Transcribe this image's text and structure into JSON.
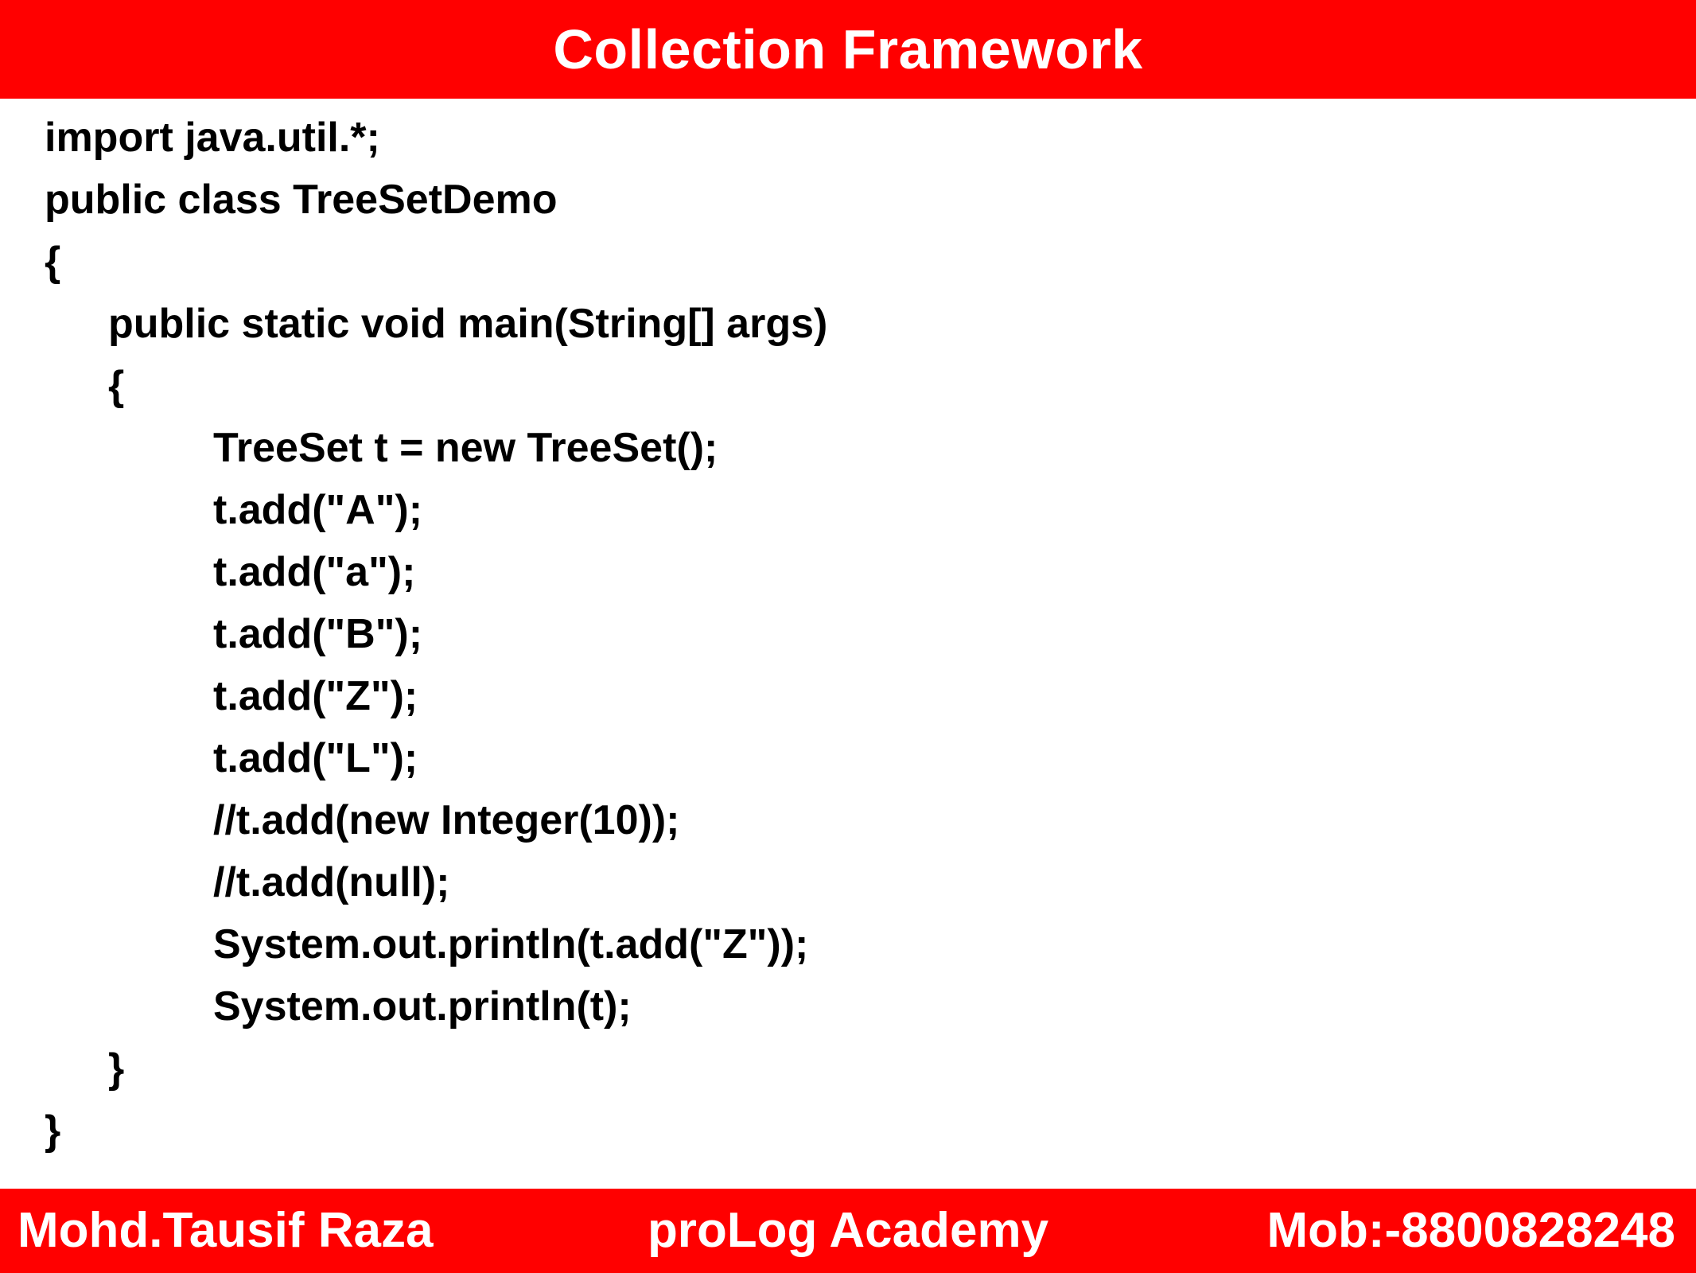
{
  "header": {
    "title": "Collection Framework"
  },
  "code": {
    "lines": [
      {
        "text": "import java.util.*;",
        "indent": 0
      },
      {
        "text": "public class TreeSetDemo",
        "indent": 0
      },
      {
        "text": "{",
        "indent": 0
      },
      {
        "text": "public static void main(String[] args)",
        "indent": 1
      },
      {
        "text": "{",
        "indent": 1
      },
      {
        "text": "TreeSet t = new TreeSet();",
        "indent": 2
      },
      {
        "text": "t.add(\"A\");",
        "indent": 2
      },
      {
        "text": "t.add(\"a\");",
        "indent": 2
      },
      {
        "text": "t.add(\"B\");",
        "indent": 2
      },
      {
        "text": "t.add(\"Z\");",
        "indent": 2
      },
      {
        "text": "t.add(\"L\");",
        "indent": 2
      },
      {
        "text": "//t.add(new Integer(10));",
        "indent": 2
      },
      {
        "text": "//t.add(null);",
        "indent": 2
      },
      {
        "text": "System.out.println(t.add(\"Z\"));",
        "indent": 2
      },
      {
        "text": "System.out.println(t);",
        "indent": 2
      },
      {
        "text": "}",
        "indent": 1
      },
      {
        "text": "}",
        "indent": 0
      }
    ]
  },
  "footer": {
    "author": "Mohd.Tausif Raza",
    "academy": "proLog Academy",
    "mobile": "Mob:-8800828248"
  },
  "colors": {
    "banner": "#ff0000",
    "banner_text": "#ffffff",
    "code_text": "#000000"
  }
}
